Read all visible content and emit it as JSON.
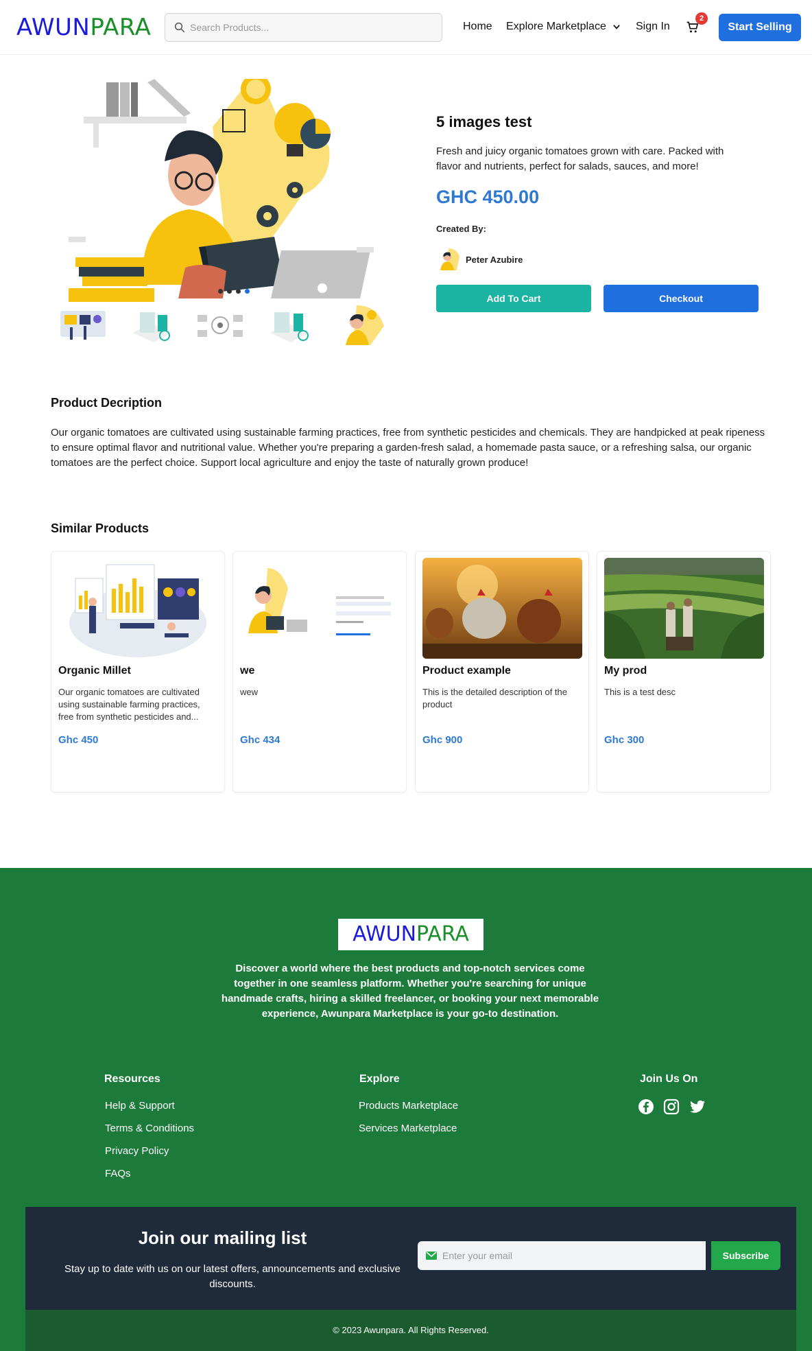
{
  "header": {
    "logo_part1": "AWUN",
    "logo_part2": "PARA",
    "search_placeholder": "Search Products...",
    "nav": {
      "home": "Home",
      "explore": "Explore Marketplace",
      "signin": "Sign In"
    },
    "cart_count": "2",
    "start_selling": "Start Selling"
  },
  "product": {
    "title": "5 images test",
    "short_description": "Fresh and juicy organic tomatoes grown with care. Packed with flavor and nutrients, perfect for salads, sauces, and more!",
    "price": "GHC 450.00",
    "created_by_label": "Created By:",
    "author": "Peter Azubire",
    "add_to_cart": "Add To Cart",
    "checkout": "Checkout"
  },
  "description": {
    "title": "Product Decription",
    "text": "Our organic tomatoes are cultivated using sustainable farming practices, free from synthetic pesticides and chemicals. They are handpicked at peak ripeness to ensure optimal flavor and nutritional value. Whether you're preparing a garden-fresh salad, a homemade pasta sauce, or a refreshing salsa, our organic tomatoes are the perfect choice. Support local agriculture and enjoy the taste of naturally grown produce!"
  },
  "similar": {
    "title": "Similar Products",
    "items": [
      {
        "name": "Organic Millet",
        "desc": "Our organic tomatoes are cultivated using sustainable farming practices, free from synthetic pesticides and...",
        "price": "Ghc 450"
      },
      {
        "name": "we",
        "desc": "wew",
        "price": "Ghc 434"
      },
      {
        "name": "Product example",
        "desc": "This is the detailed description of the product",
        "price": "Ghc 900"
      },
      {
        "name": "My prod",
        "desc": "This is a test desc",
        "price": "Ghc 300"
      }
    ]
  },
  "footer": {
    "logo_part1": "AWUN",
    "logo_part2": "PARA",
    "about": "Discover a world where the best products and top-notch services come together in one seamless platform. Whether you're searching for unique handmade crafts, hiring a skilled freelancer, or booking your next memorable experience, Awunpara Marketplace is your go-to destination.",
    "resources_title": "Resources",
    "resources": [
      "Help & Support",
      "Terms & Conditions",
      "Privacy Policy",
      "FAQs"
    ],
    "explore_title": "Explore",
    "explore": [
      "Products Marketplace",
      "Services Marketplace"
    ],
    "join_title": "Join Us On",
    "social_icons": [
      "facebook-icon",
      "instagram-icon",
      "twitter-icon"
    ],
    "mailing_title": "Join our mailing list",
    "mailing_sub": "Stay up to date with us on our latest offers, announcements and exclusive discounts.",
    "email_placeholder": "Enter your email",
    "subscribe": "Subscribe",
    "copyright": "© 2023 Awunpara. All Rights Reserved."
  },
  "colors": {
    "primary": "#1f6fde",
    "teal": "#1bb3a2",
    "footer_green": "#1c7a3a",
    "mail_dark": "#1f2a3a",
    "subscribe_green": "#22a84a"
  }
}
